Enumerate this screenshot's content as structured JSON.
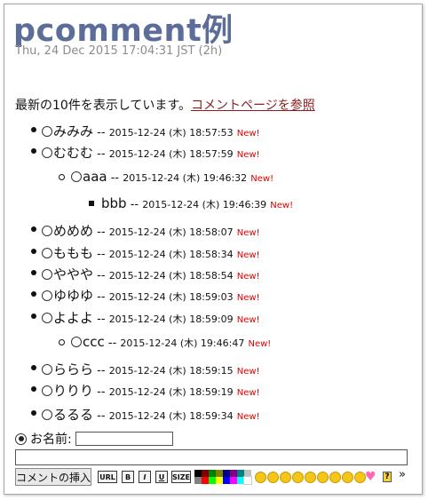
{
  "page": {
    "title": "pcomment例",
    "date": "Thu, 24 Dec 2015 17:04:31 JST (2h)",
    "intro_prefix": "最新の10件を表示しています。",
    "intro_link": "コメントページを参照"
  },
  "comments": [
    {
      "name": "みみみ",
      "sep": "--",
      "timestamp": "2015-12-24 (木) 18:57:53",
      "new": "New!"
    },
    {
      "name": "むむむ",
      "sep": "--",
      "timestamp": "2015-12-24 (木) 18:57:59",
      "new": "New!"
    },
    {
      "name": "aaa",
      "sep": "--",
      "timestamp": "2015-12-24 (木) 19:46:32",
      "new": "New!"
    },
    {
      "name": "bbb",
      "sep": "--",
      "timestamp": "2015-12-24 (木) 19:46:39",
      "new": "New!"
    },
    {
      "name": "めめめ",
      "sep": "--",
      "timestamp": "2015-12-24 (木) 18:58:07",
      "new": "New!"
    },
    {
      "name": "ももも",
      "sep": "--",
      "timestamp": "2015-12-24 (木) 18:58:34",
      "new": "New!"
    },
    {
      "name": "ややや",
      "sep": "--",
      "timestamp": "2015-12-24 (木) 18:58:54",
      "new": "New!"
    },
    {
      "name": "ゆゆゆ",
      "sep": "--",
      "timestamp": "2015-12-24 (木) 18:59:03",
      "new": "New!"
    },
    {
      "name": "よよよ",
      "sep": "--",
      "timestamp": "2015-12-24 (木) 18:59:09",
      "new": "New!"
    },
    {
      "name": "ccc",
      "sep": "--",
      "timestamp": "2015-12-24 (木) 19:46:47",
      "new": "New!"
    },
    {
      "name": "ららら",
      "sep": "--",
      "timestamp": "2015-12-24 (木) 18:59:15",
      "new": "New!"
    },
    {
      "name": "りりり",
      "sep": "--",
      "timestamp": "2015-12-24 (木) 18:59:19",
      "new": "New!"
    },
    {
      "name": "るるる",
      "sep": "--",
      "timestamp": "2015-12-24 (木) 18:59:34",
      "new": "New!"
    }
  ],
  "form": {
    "name_label": "お名前:",
    "name_value": "",
    "comment_value": "",
    "submit_label": "コメントの挿入",
    "toolbar": {
      "url": "URL",
      "bold": "B",
      "italic": "I",
      "underline": "U",
      "size": "SIZE",
      "help": "?",
      "more": "»"
    }
  },
  "colors": {
    "title": "#5d6d99",
    "link": "#8b1e1e",
    "new_badge": "#e00000"
  },
  "icons": {
    "palette": "color-palette-icon",
    "smileys": "smiley-face-icon",
    "heart": "heart-icon",
    "help": "help-icon"
  }
}
